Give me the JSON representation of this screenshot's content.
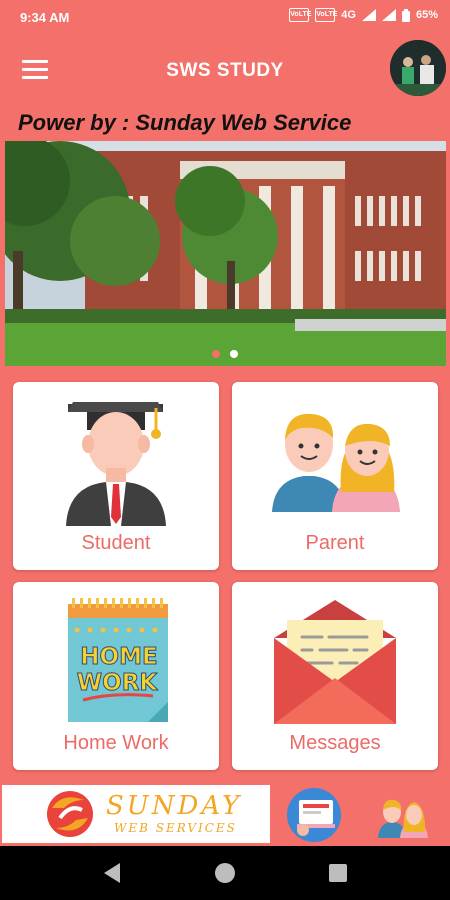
{
  "status": {
    "time": "9:34 AM",
    "volte1": "VoLTE",
    "volte2": "VoLTE",
    "network": "4G",
    "battery": "65%"
  },
  "app": {
    "title": "SWS STUDY"
  },
  "powered_by": "Power by : Sunday Web Service",
  "carousel": {
    "total": 2,
    "active": 1
  },
  "cards": [
    {
      "label": "Student",
      "icon": "graduate-icon"
    },
    {
      "label": "Parent",
      "icon": "parents-icon"
    },
    {
      "label": "Home Work",
      "icon": "homework-notebook-icon"
    },
    {
      "label": "Messages",
      "icon": "envelope-icon"
    }
  ],
  "footer": {
    "brand": "SUNDAY",
    "brand_sub": "WEB SERVICES"
  },
  "colors": {
    "accent": "#f4706a",
    "label": "#ec6b66",
    "brand": "#f3a523"
  }
}
